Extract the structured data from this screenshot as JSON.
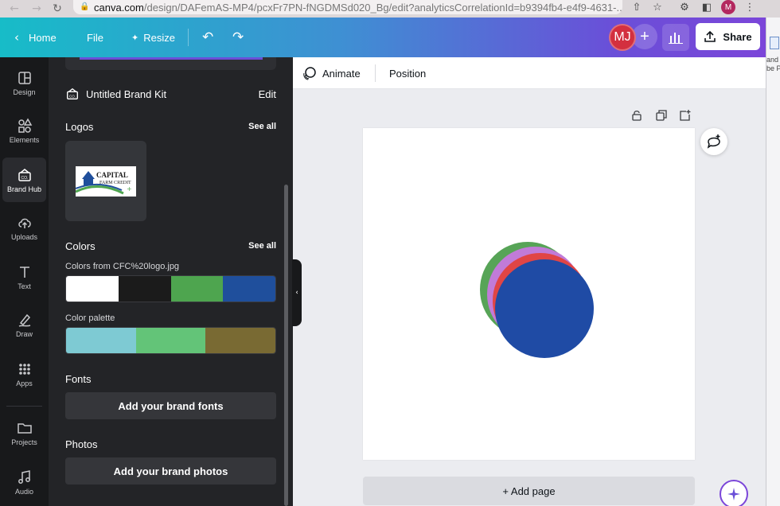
{
  "browser": {
    "url_host": "canva.com",
    "url_path": "/design/DAFemAS-MP4/pcxFr7PN-fNGDMSd020_Bg/edit?analyticsCorrelationId=b9394fb4-e4f9-4631-...",
    "profile_initial": "M"
  },
  "topbar": {
    "home_label": "Home",
    "file_label": "File",
    "resize_label": "Resize",
    "avatar_initials": "MJ",
    "share_label": "Share"
  },
  "rail": {
    "items": [
      {
        "label": "Design",
        "icon": "layout-icon"
      },
      {
        "label": "Elements",
        "icon": "shapes-icon"
      },
      {
        "label": "Brand Hub",
        "icon": "brand-hub-icon"
      },
      {
        "label": "Uploads",
        "icon": "cloud-upload-icon"
      },
      {
        "label": "Text",
        "icon": "text-icon"
      },
      {
        "label": "Draw",
        "icon": "draw-icon"
      },
      {
        "label": "Apps",
        "icon": "apps-icon"
      },
      {
        "label": "Projects",
        "icon": "folder-icon"
      },
      {
        "label": "Audio",
        "icon": "music-icon"
      }
    ]
  },
  "panel": {
    "brand_kit_title": "Untitled Brand Kit",
    "edit_label": "Edit",
    "logos_title": "Logos",
    "logos_see_all": "See all",
    "logo_text_line1": "CAPITAL",
    "logo_text_line2": "FARM CREDIT",
    "colors_title": "Colors",
    "colors_see_all": "See all",
    "colors_from_label": "Colors from CFC%20logo.jpg",
    "logo_colors": [
      "#ffffff",
      "#1b1b1b",
      "#4ea54f",
      "#1f4f9c"
    ],
    "palette_label": "Color palette",
    "palette_colors": [
      "#7ecad3",
      "#63c478",
      "#796a33"
    ],
    "fonts_title": "Fonts",
    "fonts_button": "Add your brand fonts",
    "photos_title": "Photos",
    "photos_button": "Add your brand photos"
  },
  "context_bar": {
    "animate_label": "Animate",
    "position_label": "Position"
  },
  "canvas": {
    "circle_colors": [
      "#57a457",
      "#c17bd8",
      "#e04545",
      "#1f4ba5"
    ],
    "add_page_label": "+ Add page"
  },
  "sliver": {
    "text1": "and",
    "text2": "be P"
  }
}
